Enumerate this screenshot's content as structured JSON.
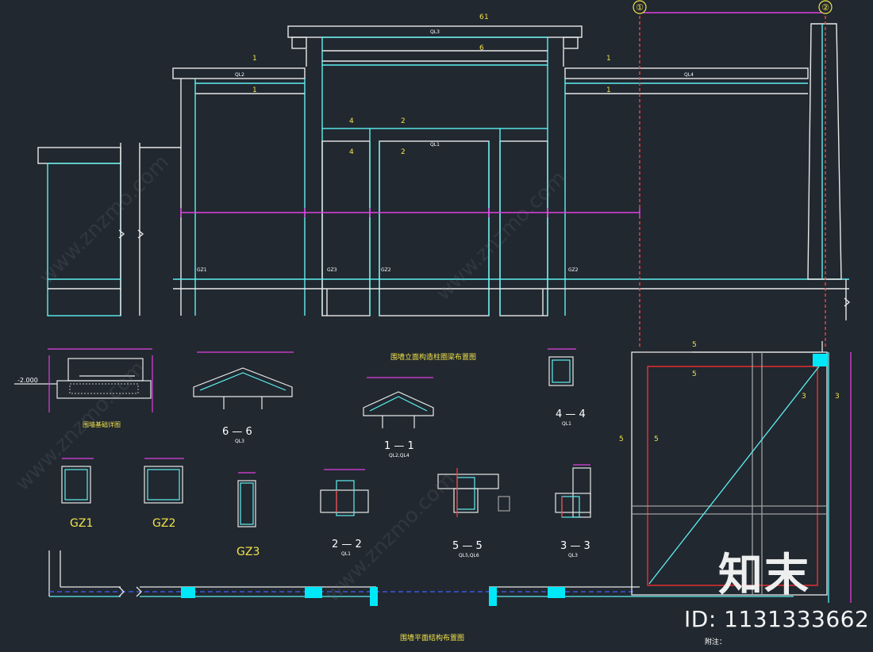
{
  "grid_axes": {
    "axis_1": "①",
    "axis_2": "②"
  },
  "elevation": {
    "section_marks": [
      "6",
      "6",
      "1",
      "1",
      "1",
      "1",
      "1",
      "4",
      "2",
      "4",
      "2"
    ],
    "small_labels": [
      "QL3",
      "QL2",
      "QL1",
      "QL4"
    ],
    "column_labels": [
      "GZ1",
      "GZ3",
      "GZ2",
      "GZ2"
    ]
  },
  "headings": {
    "elevation_title": "围墙立面构造柱圈梁布置图",
    "foundation_title": "围墙基础详图",
    "plan_title": "围墙平面结构布置图",
    "notes_title": "附注："
  },
  "foundation": {
    "level": "-2.000"
  },
  "sections": [
    {
      "name": "6 — 6",
      "sub": "QL3"
    },
    {
      "name": "1 — 1",
      "sub": "QL2,QL4"
    },
    {
      "name": "4 — 4",
      "sub": "QL1"
    },
    {
      "name": "2 — 2",
      "sub": "QL1"
    },
    {
      "name": "5 — 5",
      "sub": "QL5,QL6"
    },
    {
      "name": "3 — 3",
      "sub": "QL3"
    }
  ],
  "columns": [
    {
      "name": "GZ1"
    },
    {
      "name": "GZ2"
    },
    {
      "name": "GZ3"
    }
  ],
  "detail_marks": [
    "5",
    "5",
    "5",
    "5",
    "3",
    "3"
  ],
  "watermark": {
    "logo": "知末",
    "id": "ID: 1131333662",
    "site": "www.znzmo.com"
  }
}
